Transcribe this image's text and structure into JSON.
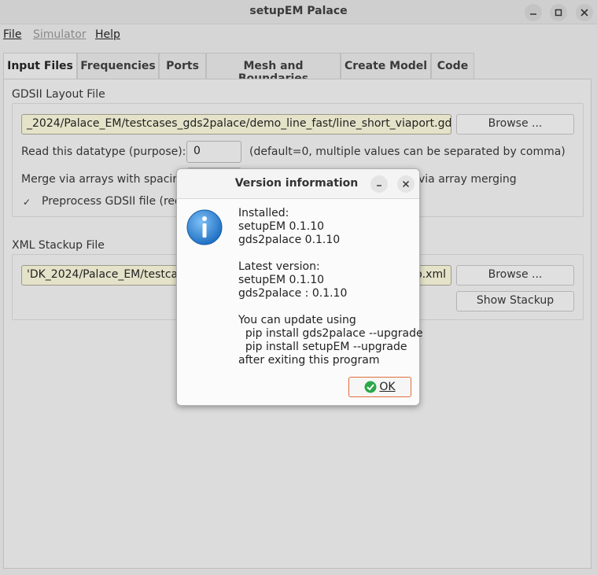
{
  "window": {
    "title": "setupEM Palace"
  },
  "menubar": {
    "file": "File",
    "simulator": "Simulator",
    "help": "Help"
  },
  "tabs": [
    {
      "label": "Input Files",
      "active": true
    },
    {
      "label": "Frequencies"
    },
    {
      "label": "Ports"
    },
    {
      "label": "Mesh and Boundaries"
    },
    {
      "label": "Create Model"
    },
    {
      "label": "Code"
    }
  ],
  "gdsii": {
    "group_label": "GDSII Layout File",
    "path": "_2024/Palace_EM/testcases_gds2palace/demo_line_fast/line_short_viaport.gds",
    "browse_label": "Browse ...",
    "datatype_label": "Read this datatype (purpose):",
    "datatype_value": "0",
    "datatype_hint": "(default=0, multiple values can be separated by comma)",
    "merge_label": "Merge via arrays with spacing",
    "merge_hint": "via array merging",
    "preprocess_label": "Preprocess GDSII file (requ",
    "preprocess_checked": true
  },
  "xml": {
    "group_label": "XML Stackup File",
    "path_left": "'DK_2024/Palace_EM/testcas",
    "path_right": "p.xml",
    "browse_label": "Browse ...",
    "show_stackup_label": "Show Stackup"
  },
  "dialog": {
    "title": "Version information",
    "lines": [
      "Installed:",
      "setupEM 0.1.10",
      "gds2palace 0.1.10",
      "",
      "Latest version:",
      "setupEM 0.1.10",
      "gds2palace : 0.1.10",
      "",
      "You can update using",
      "  pip install gds2palace --upgrade",
      "  pip install setupEM --upgrade",
      "after exiting this program"
    ],
    "ok_label": "OK",
    "icon": "info-icon"
  },
  "colors": {
    "field_bg": "#e4e2c8",
    "info_blue": "#2f86d6",
    "ok_border": "#e06c3c",
    "ok_check": "#2aa84a"
  }
}
